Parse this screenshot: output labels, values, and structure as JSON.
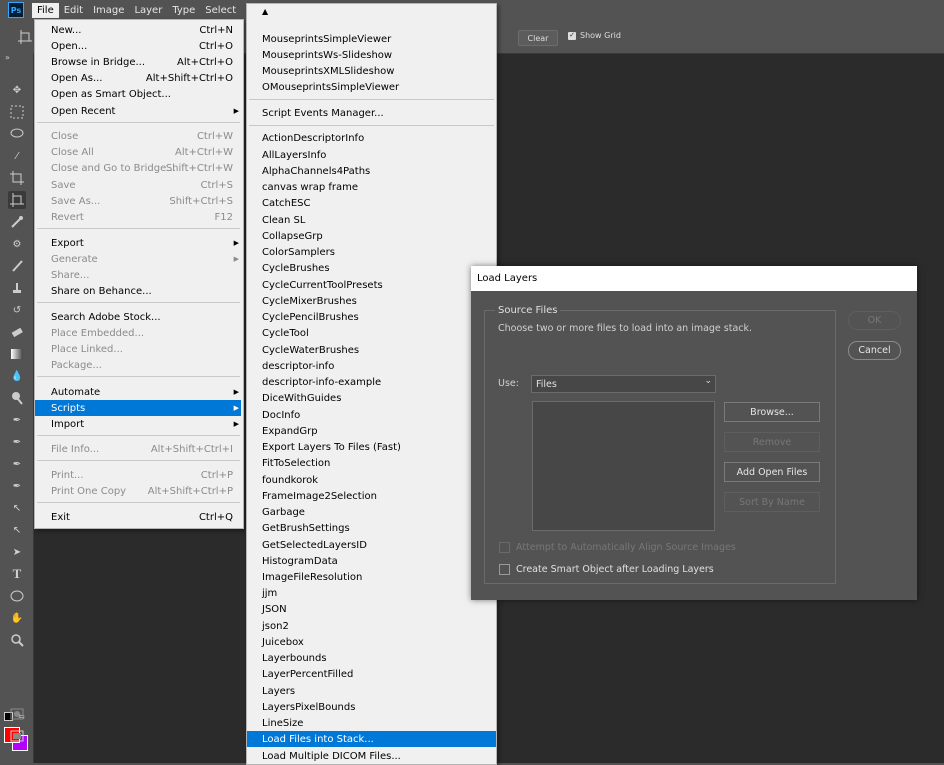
{
  "app": {
    "logo": "Ps"
  },
  "menubar": {
    "items": [
      "File",
      "Edit",
      "Image",
      "Layer",
      "Type",
      "Select"
    ]
  },
  "options": {
    "clear_label": "Clear",
    "show_grid_label": "Show Grid",
    "show_grid_checked": true
  },
  "file_menu": {
    "items": [
      {
        "label": "New...",
        "shortcut": "Ctrl+N",
        "disabled": false
      },
      {
        "label": "Open...",
        "shortcut": "Ctrl+O",
        "disabled": false
      },
      {
        "label": "Browse in Bridge...",
        "shortcut": "Alt+Ctrl+O",
        "disabled": false
      },
      {
        "label": "Open As...",
        "shortcut": "Alt+Shift+Ctrl+O",
        "disabled": false
      },
      {
        "label": "Open as Smart Object...",
        "shortcut": "",
        "disabled": false
      },
      {
        "label": "Open Recent",
        "shortcut": "",
        "disabled": false,
        "submenu": true
      },
      {
        "label": "Close",
        "shortcut": "Ctrl+W",
        "disabled": true
      },
      {
        "label": "Close All",
        "shortcut": "Alt+Ctrl+W",
        "disabled": true
      },
      {
        "label": "Close and Go to Bridge...",
        "shortcut": "Shift+Ctrl+W",
        "disabled": true
      },
      {
        "label": "Save",
        "shortcut": "Ctrl+S",
        "disabled": true
      },
      {
        "label": "Save As...",
        "shortcut": "Shift+Ctrl+S",
        "disabled": true
      },
      {
        "label": "Revert",
        "shortcut": "F12",
        "disabled": true
      },
      {
        "label": "Export",
        "shortcut": "",
        "disabled": false,
        "submenu": true
      },
      {
        "label": "Generate",
        "shortcut": "",
        "disabled": true,
        "submenu": true
      },
      {
        "label": "Share...",
        "shortcut": "",
        "disabled": true
      },
      {
        "label": "Share on Behance...",
        "shortcut": "",
        "disabled": false
      },
      {
        "label": "Search Adobe Stock...",
        "shortcut": "",
        "disabled": false
      },
      {
        "label": "Place Embedded...",
        "shortcut": "",
        "disabled": true
      },
      {
        "label": "Place Linked...",
        "shortcut": "",
        "disabled": true
      },
      {
        "label": "Package...",
        "shortcut": "",
        "disabled": true
      },
      {
        "label": "Automate",
        "shortcut": "",
        "disabled": false,
        "submenu": true
      },
      {
        "label": "Scripts",
        "shortcut": "",
        "disabled": false,
        "submenu": true,
        "highlighted": true
      },
      {
        "label": "Import",
        "shortcut": "",
        "disabled": false,
        "submenu": true
      },
      {
        "label": "File Info...",
        "shortcut": "Alt+Shift+Ctrl+I",
        "disabled": true
      },
      {
        "label": "Print...",
        "shortcut": "Ctrl+P",
        "disabled": true
      },
      {
        "label": "Print One Copy",
        "shortcut": "Alt+Shift+Ctrl+P",
        "disabled": true
      },
      {
        "label": "Exit",
        "shortcut": "Ctrl+Q",
        "disabled": false
      }
    ]
  },
  "scripts_menu": {
    "items": [
      "MouseprintsSimpleViewer",
      "MouseprintsWs-Slideshow",
      "MouseprintsXMLSlideshow",
      "OMouseprintsSimpleViewer",
      "Script Events Manager...",
      "ActionDescriptorInfo",
      "AllLayersInfo",
      "AlphaChannels4Paths",
      "canvas wrap frame",
      "CatchESC",
      "Clean SL",
      "CollapseGrp",
      "ColorSamplers",
      "CycleBrushes",
      "CycleCurrentToolPresets",
      "CycleMixerBrushes",
      "CyclePencilBrushes",
      "CycleTool",
      "CycleWaterBrushes",
      "descriptor-info",
      "descriptor-info-example",
      "DiceWithGuides",
      "DocInfo",
      "ExpandGrp",
      "Export Layers To Files (Fast)",
      "FitToSelection",
      "foundkorok",
      "FrameImage2Selection",
      "Garbage",
      "GetBrushSettings",
      "GetSelectedLayersID",
      "HistogramData",
      "ImageFileResolution",
      "jjm",
      "JSON",
      "json2",
      "Juicebox",
      "Layerbounds",
      "LayerPercentFilled",
      "Layers",
      "LayersPixelBounds",
      "LineSize",
      "Load Files into Stack...",
      "Load Multiple DICOM Files..."
    ],
    "highlighted": "Load Files into Stack..."
  },
  "dialog": {
    "title": "Load Layers",
    "source_group_label": "Source Files",
    "description": "Choose two or more files to load into an image stack.",
    "use_label": "Use:",
    "use_value": "Files",
    "browse": "Browse...",
    "remove": "Remove",
    "add_open_files": "Add Open Files",
    "sort_by_name": "Sort By Name",
    "ok": "OK",
    "cancel": "Cancel",
    "align_label": "Attempt to Automatically Align Source Images",
    "smart_object_label": "Create Smart Object after Loading Layers"
  }
}
